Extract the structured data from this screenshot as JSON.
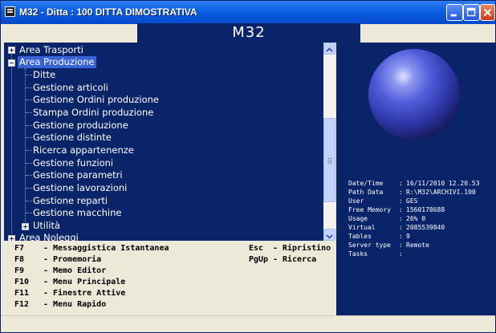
{
  "window": {
    "title": "M32 - Ditta : 100 DITTA DIMOSTRATIVA",
    "banner": "M32"
  },
  "tree": {
    "items": [
      {
        "label": "Area Trasporti",
        "level": 0,
        "expander": "plus",
        "selected": false
      },
      {
        "label": "Area Produzione",
        "level": 0,
        "expander": "minus",
        "selected": true
      },
      {
        "label": "Ditte",
        "level": 1
      },
      {
        "label": "Gestione articoli",
        "level": 1
      },
      {
        "label": "Gestione Ordini produzione",
        "level": 1
      },
      {
        "label": "Stampa Ordini produzione",
        "level": 1
      },
      {
        "label": "Gestione produzione",
        "level": 1
      },
      {
        "label": "Gestione distinte",
        "level": 1
      },
      {
        "label": "Ricerca appartenenze",
        "level": 1
      },
      {
        "label": "Gestione funzioni",
        "level": 1
      },
      {
        "label": "Gestione parametri",
        "level": 1
      },
      {
        "label": "Gestione lavorazioni",
        "level": 1
      },
      {
        "label": "Gestione reparti",
        "level": 1
      },
      {
        "label": "Gestione macchine",
        "level": 1
      },
      {
        "label": "Utilità",
        "level": 1,
        "expander": "plus"
      },
      {
        "label": "Area Noleggi",
        "level": 0,
        "expander": "plus"
      }
    ]
  },
  "info": {
    "rows": [
      {
        "label": "Date/Time",
        "value": "16/11/2010  12.20.53"
      },
      {
        "label": "Path Data",
        "value": "R:\\M32\\ARCHIVI.100"
      },
      {
        "label": "User",
        "value": "GES"
      },
      {
        "label": "Free Memory",
        "value": "1560178688"
      },
      {
        "label": "Usage",
        "value": "26% 0"
      },
      {
        "label": "Virtual",
        "value": "2085539840"
      },
      {
        "label": "Tables",
        "value": "9"
      },
      {
        "label": "Server type",
        "value": "Remote"
      },
      {
        "label": "Tasks",
        "value": ""
      }
    ]
  },
  "shortcuts": {
    "left": [
      {
        "key": "F7",
        "label": "Messaggistica Istantanea"
      },
      {
        "key": "F8",
        "label": "Promemoria"
      },
      {
        "key": "F9",
        "label": "Memo Editor"
      },
      {
        "key": "F10",
        "label": "Menu Principale"
      },
      {
        "key": "F11",
        "label": "Finestre Attive"
      },
      {
        "key": "F12",
        "label": "Menu Rapido"
      }
    ],
    "right": [
      {
        "key": "Esc",
        "label": "Ripristino"
      },
      {
        "key": "PgUp",
        "label": "Ricerca"
      }
    ]
  },
  "colors": {
    "panel_bg": "#0a246a",
    "selection": "#3763d6",
    "titlebar": "#0a5ee0"
  }
}
